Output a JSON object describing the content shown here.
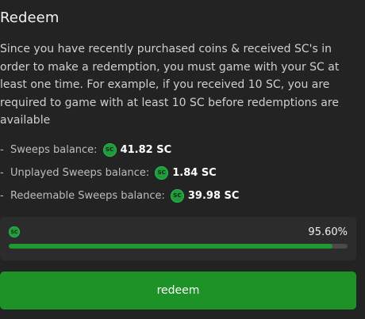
{
  "header": {
    "title": "Redeem"
  },
  "description": "Since you have recently purchased coins & received SC's in order to make a redemption, you must game with your SC at least one time. For example, if you received 10 SC, you are required to game with at least 10 SC before redemptions are available",
  "coin_badge": "SC",
  "balances": [
    {
      "label": "-  Sweeps balance:",
      "value": "41.82 SC"
    },
    {
      "label": "-  Unplayed Sweeps balance:",
      "value": "1.84 SC"
    },
    {
      "label": "-  Redeemable Sweeps balance:",
      "value": "39.98 SC"
    }
  ],
  "progress": {
    "percent_text": "95.60%",
    "fraction": 0.956
  },
  "redeem_button": {
    "label": "redeem"
  },
  "colors": {
    "background": "#232323",
    "accent_green": "#1c9227",
    "coin_green": "#1f9b3c"
  },
  "icons": {
    "coin": "sc-coin-icon"
  }
}
